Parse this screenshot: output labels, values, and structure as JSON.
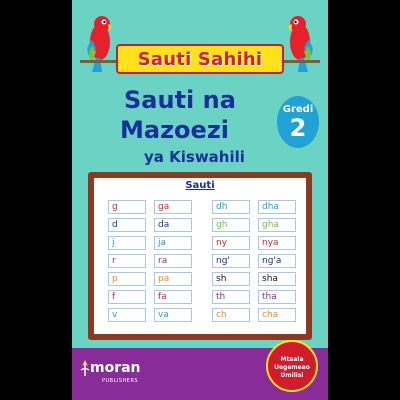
{
  "cover": {
    "banner": "Sauti Sahihi",
    "title_line1": "Sauti na",
    "title_line2": "Mazoezi",
    "title_line3": "ya Kiswahili",
    "grade_label": "Gredi",
    "grade_number": "2",
    "board_heading": "Sauti",
    "left_pairs": [
      {
        "single": "g",
        "syllable": "ga",
        "color": "#e8202c"
      },
      {
        "single": "d",
        "syllable": "da",
        "color": "#17309a"
      },
      {
        "single": "j",
        "syllable": "ja",
        "color": "#1fa3d6"
      },
      {
        "single": "r",
        "syllable": "ra",
        "color": "#8a2b9a"
      },
      {
        "single": "p",
        "syllable": "pa",
        "color": "#f28c1c"
      },
      {
        "single": "f",
        "syllable": "fa",
        "color": "#e8202c"
      },
      {
        "single": "v",
        "syllable": "va",
        "color": "#1fa3d6"
      }
    ],
    "right_pairs": [
      {
        "single": "dh",
        "syllable": "dha",
        "color": "#1fa3d6"
      },
      {
        "single": "gh",
        "syllable": "gha",
        "color": "#7ac142"
      },
      {
        "single": "ny",
        "syllable": "nya",
        "color": "#e8202c"
      },
      {
        "single": "ng'",
        "syllable": "ng'a",
        "color": "#17309a"
      },
      {
        "single": "sh",
        "syllable": "sha",
        "color": "#1a1a1a"
      },
      {
        "single": "th",
        "syllable": "tha",
        "color": "#8a2b9a"
      },
      {
        "single": "ch",
        "syllable": "cha",
        "color": "#f28c1c"
      }
    ],
    "publisher": "moran",
    "publisher_sub": "PUBLISHERS",
    "seal_lines": [
      "Mtaala",
      "Uegemeao",
      "Umilisi"
    ]
  },
  "colors": {
    "background": "#6ad3c4",
    "title": "#17309a",
    "banner": "#ffe21a",
    "board_frame": "#8b3a1f",
    "footer": "#8a2b9a",
    "seal": "#d21c2c"
  }
}
